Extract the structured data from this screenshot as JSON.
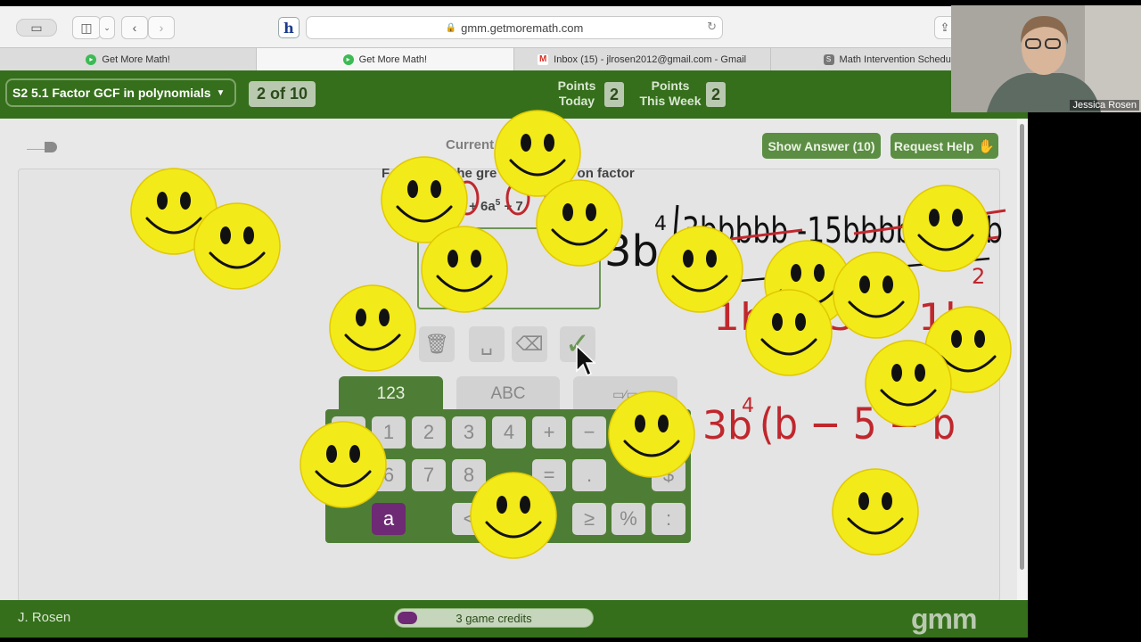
{
  "browser": {
    "url": "gmm.getmoremath.com",
    "tabs": [
      {
        "label": "Get More Math!",
        "active": false,
        "favicon": "green-circle-icon"
      },
      {
        "label": "Get More Math!",
        "active": true,
        "favicon": "green-circle-icon"
      },
      {
        "label": "Inbox (15) - jlrosen2012@gmail.com - Gmail",
        "active": false,
        "favicon": "gmail-icon"
      },
      {
        "label": "Math Intervention Schedule SY",
        "active": false,
        "favicon": "sheets-icon"
      }
    ]
  },
  "header": {
    "skill_dropdown": "S2 5.1 Factor GCF in polynomials",
    "progress": "2 of 10",
    "points_today_label_1": "Points",
    "points_today_label_2": "Today",
    "points_today_value": "2",
    "points_week_label_1": "Points",
    "points_week_label_2": "This Week",
    "points_week_value": "2"
  },
  "card": {
    "current_label": "Current",
    "show_answer": "Show Answer (10)",
    "request_help": "Request Help",
    "question_start": "F",
    "question_mid": "the gre",
    "question_end": "on factor",
    "expr_part1": "a",
    "expr_part2": "+ 6a",
    "expr_part3": "+ 7"
  },
  "keyboard": {
    "tabs": [
      "123",
      "ABC"
    ],
    "row1": [
      "1",
      "2",
      "3",
      "4",
      "+",
      "−"
    ],
    "row2": [
      "6",
      "7",
      "8",
      "=",
      ".",
      "$"
    ],
    "row3_var": "a",
    "row3": [
      "<",
      "≥",
      "%",
      ":"
    ]
  },
  "footer": {
    "user": "J. Rosen",
    "credits": "3 game credits",
    "logo": "gmm"
  },
  "video": {
    "name": "Jessica Rosen"
  },
  "handwriting": {
    "black_1": "3b",
    "black_exp": "4",
    "black_2": "3bbbbb -15bbbb -3bbb",
    "black_3": "bbb",
    "red_row1": "1b − 5 − 1b",
    "red_row1_exp": "2",
    "red_result": "3b",
    "red_result_exp": "4",
    "red_result_paren": "(b − 5 − b",
    "red_result_paren_exp": "2"
  },
  "colors": {
    "gmm_green": "#356f1b",
    "accent_purple": "#6e2a74",
    "smiley_yellow": "#f3ea1a",
    "ink_red": "#c0272d"
  }
}
